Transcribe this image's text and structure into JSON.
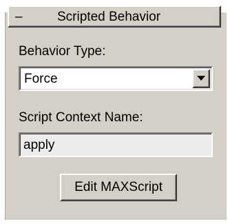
{
  "rollout": {
    "toggle_symbol": "–",
    "title": "Scripted Behavior"
  },
  "behavior_type": {
    "label": "Behavior Type:",
    "selected": "Force"
  },
  "script_context": {
    "label": "Script Context Name:",
    "value": "apply"
  },
  "actions": {
    "edit_label": "Edit MAXScript"
  },
  "colors": {
    "panel_bg": "#d4d0c8",
    "field_bg": "#ffffff",
    "text": "#000000"
  }
}
